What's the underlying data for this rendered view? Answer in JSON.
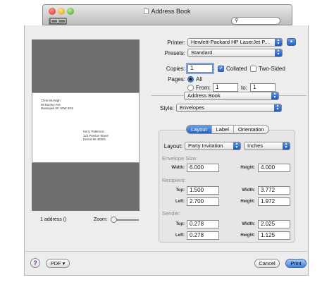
{
  "window": {
    "title": "Address Book",
    "search_placeholder": ""
  },
  "preview": {
    "return_address": [
      "Chris McVeigh",
      "59 Burney Ave",
      "Mossejaw SK S0W 3G6"
    ],
    "recipient_address": [
      "Kerry Patterson",
      "123 Preston Street",
      "Detroit MI 48204"
    ],
    "count_label": "1 address ()",
    "zoom_label": "Zoom:"
  },
  "printer": {
    "label": "Printer:",
    "value": "Hewlett-Packard HP LaserJet P..."
  },
  "presets": {
    "label": "Presets:",
    "value": "Standard"
  },
  "copies": {
    "label": "Copies:",
    "value": "1",
    "collated_label": "Collated",
    "collated": true,
    "two_sided_label": "Two-Sided",
    "two_sided": false
  },
  "pages": {
    "label": "Pages:",
    "all_label": "All",
    "from_label": "From:",
    "from_value": "1",
    "to_label": "to:",
    "to_value": "1",
    "selected": "All"
  },
  "app_popup": {
    "value": "Address Book"
  },
  "style": {
    "label": "Style:",
    "value": "Envelopes"
  },
  "tabs": [
    {
      "label": "Layout",
      "selected": true
    },
    {
      "label": "Label",
      "selected": false
    },
    {
      "label": "Orientation",
      "selected": false
    }
  ],
  "layout": {
    "label": "Layout:",
    "value": "Party Invitation",
    "units": "Inches",
    "envelope_size": {
      "title": "Envelope Size:",
      "width_label": "Width:",
      "width": "6.000",
      "height_label": "Height:",
      "height": "4.000"
    },
    "recipient": {
      "title": "Recipient:",
      "top_label": "Top:",
      "top": "1.500",
      "width_label": "Width:",
      "width": "3.772",
      "left_label": "Left:",
      "left": "2.700",
      "height_label": "Height:",
      "height": "1.972"
    },
    "sender": {
      "title": "Sender:",
      "top_label": "Top:",
      "top": "0.278",
      "width_label": "Width:",
      "width": "2.025",
      "left_label": "Left:",
      "left": "0.278",
      "height_label": "Height:",
      "height": "1.125"
    }
  },
  "footer": {
    "help": "?",
    "pdf_label": "PDF ▾",
    "cancel_label": "Cancel",
    "print_label": "Print"
  }
}
